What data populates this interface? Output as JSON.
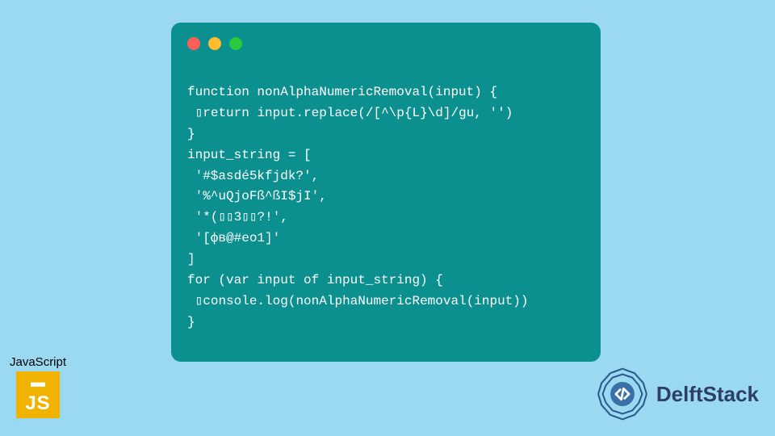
{
  "code": {
    "lines": [
      "function nonAlphaNumericRemoval(input) {",
      " ▯return input.replace(/[^\\p{L}\\d]/gu, '')",
      "}",
      "input_string = [",
      " '#$asdé5kfjdk?',",
      " '%^uQjoFß^ßI$jI',",
      " '*(▯▯3▯▯?!',",
      " '[фв@#еo1]'",
      "]",
      "for (var input of input_string) {",
      " ▯console.log(nonAlphaNumericRemoval(input))",
      "}"
    ]
  },
  "badge": {
    "language_label": "JavaScript",
    "logo_text": "JS"
  },
  "brand": {
    "name": "DelftStack"
  },
  "colors": {
    "page_bg": "#9bd8f2",
    "window_bg": "#0b8f8f",
    "code_text": "#ffffff",
    "js_logo_bg": "#f0b400",
    "brand_text": "#2c3e6a"
  }
}
